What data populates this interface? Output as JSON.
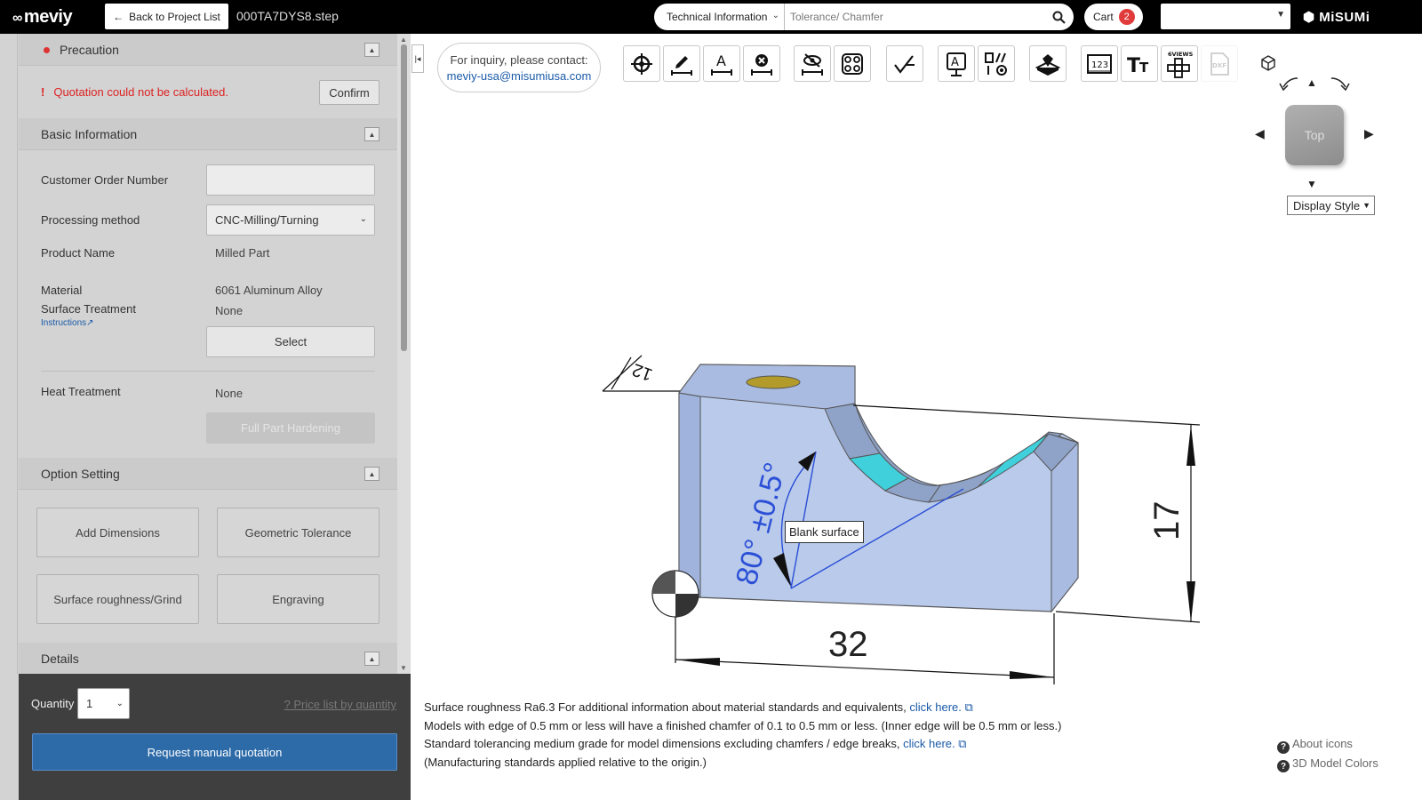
{
  "header": {
    "logo": "meviy",
    "back_label": "Back to Project List",
    "filename": "000TA7DYS8.step",
    "tech_select": "Technical Information",
    "search_placeholder": "Tolerance/ Chamfer",
    "cart_label": "Cart",
    "cart_count": "2",
    "brand": "MiSUMi"
  },
  "precaution": {
    "title": "Precaution",
    "warning": "Quotation could not be calculated.",
    "confirm_label": "Confirm"
  },
  "basic_info": {
    "title": "Basic Information",
    "customer_order_label": "Customer Order Number",
    "customer_order_value": "",
    "processing_label": "Processing method",
    "processing_value": "CNC-Milling/Turning",
    "product_name_label": "Product Name",
    "product_name_value": "Milled Part",
    "material_label": "Material",
    "material_value": "6061 Aluminum Alloy",
    "surface_label": "Surface Treatment",
    "surface_value": "None",
    "instructions_link": "Instructions",
    "select_label": "Select",
    "heat_label": "Heat Treatment",
    "heat_value": "None",
    "hardening_label": "Full Part Hardening"
  },
  "option_setting": {
    "title": "Option Setting",
    "buttons": [
      "Add Dimensions",
      "Geometric Tolerance",
      "Surface roughness/Grind",
      "Engraving"
    ]
  },
  "details": {
    "title": "Details"
  },
  "quantity": {
    "label": "Quantity",
    "value": "1",
    "price_link": "Price list by quantity",
    "request_label": "Request manual quotation"
  },
  "inquiry": {
    "line1": "For inquiry, please contact:",
    "email": "meviy-usa@misumiusa.com"
  },
  "toolbar": {
    "icons": [
      "origin-icon",
      "dimension-edit-icon",
      "dimension-text-icon",
      "dimension-delete-icon",
      "hide-dimension-icon",
      "select-features-icon",
      "surface-roughness-icon",
      "engraving-icon",
      "geometric-tolerance-icon",
      "pin-icon",
      "tabular-dimension-icon",
      "text-size-icon",
      "six-views-icon",
      "dxf-icon"
    ],
    "six_views_label": "6VIEWS",
    "dxf_label": "DXF"
  },
  "viewer": {
    "cube_face": "Top",
    "display_style": "Display Style",
    "dim_width": "32",
    "dim_height": "17",
    "dim_depth": "12",
    "dim_angle": "80° ±0.5°",
    "tooltip": "Blank surface",
    "colors": {
      "face": "#b9caeb",
      "highlight": "#3fd0dc",
      "hole": "#b39b2b",
      "dimension": "#2b4fd6"
    }
  },
  "notes": {
    "line1_text": "Surface roughness Ra6.3    For additional information about material standards and equivalents,",
    "line1_link": "click here.",
    "line2": "Models with edge of 0.5 mm or less will have a finished chamfer of 0.1 to 0.5 mm or less. (Inner edge will be 0.5 mm or less.)",
    "line3_text": "Standard tolerancing medium grade for model dimensions excluding chamfers / edge breaks,",
    "line3_link": "click here.",
    "line4": "(Manufacturing standards applied relative to the origin.)"
  },
  "help": {
    "about_icons": "About icons",
    "model_colors": "3D Model Colors"
  }
}
